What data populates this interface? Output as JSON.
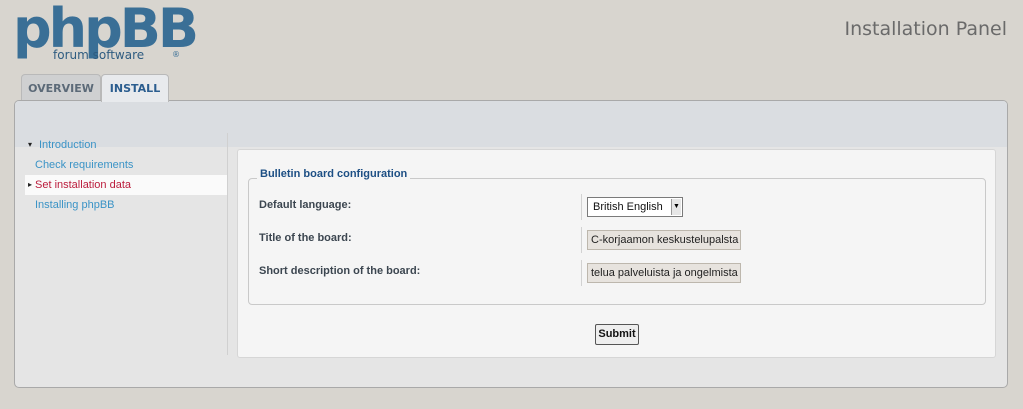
{
  "header": {
    "logo_main": "phpBB",
    "logo_sub": "forum  software",
    "logo_mark": "®",
    "panel_title": "Installation Panel"
  },
  "tabs": [
    {
      "label": "OVERVIEW",
      "active": false
    },
    {
      "label": "INSTALL",
      "active": true
    }
  ],
  "menu": {
    "items": [
      {
        "label": "Introduction",
        "state": "expanded"
      },
      {
        "label": "Check requirements",
        "state": "normal"
      },
      {
        "label": "Set installation data",
        "state": "active"
      },
      {
        "label": "Installing phpBB",
        "state": "normal"
      }
    ],
    "arrow_open": "▾",
    "arrow_active": "▸"
  },
  "form": {
    "legend": "Bulletin board configuration",
    "fields": [
      {
        "label": "Default language:",
        "type": "select",
        "value": "British English"
      },
      {
        "label": "Title of the board:",
        "type": "text",
        "value": "C-korjaamon keskustelupalsta"
      },
      {
        "label": "Short description of the board:",
        "type": "text",
        "value": "telua palveluista ja ongelmista"
      }
    ],
    "submit_label": "Submit"
  },
  "colors": {
    "brand": "#3a6f96",
    "link": "#3a93c6",
    "active_link": "#bb1c3c",
    "legend": "#1d4f84",
    "background": "#d8d5cf"
  }
}
